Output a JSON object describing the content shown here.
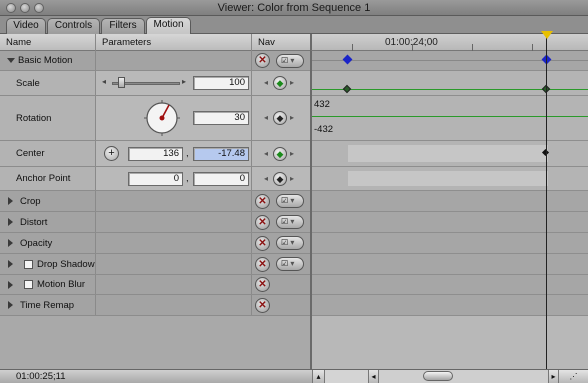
{
  "window": {
    "title": "Viewer: Color from Sequence 1"
  },
  "tabs": [
    {
      "label": "Video"
    },
    {
      "label": "Controls"
    },
    {
      "label": "Filters"
    },
    {
      "label": "Motion"
    }
  ],
  "columns": {
    "name": "Name",
    "parameters": "Parameters",
    "nav": "Nav"
  },
  "timeline": {
    "timecode": "01:00:24;00",
    "rotation_max": "432",
    "rotation_min": "-432"
  },
  "motion": {
    "basic_motion": {
      "label": "Basic Motion"
    },
    "scale": {
      "label": "Scale",
      "value": "100",
      "slider_fraction": 0.1
    },
    "rotation": {
      "label": "Rotation",
      "value": "30"
    },
    "center": {
      "label": "Center",
      "x": "136",
      "y": "-17.48",
      "separator": ","
    },
    "anchor": {
      "label": "Anchor Point",
      "x": "0",
      "y": "0",
      "separator": ","
    },
    "sections": [
      {
        "label": "Crop"
      },
      {
        "label": "Distort"
      },
      {
        "label": "Opacity"
      },
      {
        "label": "Drop Shadow"
      },
      {
        "label": "Motion Blur"
      },
      {
        "label": "Time Remap"
      }
    ]
  },
  "status": {
    "timecode": "01:00:25;11"
  },
  "icons": {
    "reset": "x-circle-icon",
    "menu": "checkmark-menu-icon",
    "keyframe": "diamond-keyframe-icon"
  },
  "colors": {
    "accent_selection": "#b6c9ee",
    "keyframe_blue": "#1a24c8",
    "curve_green": "#2a9a2a",
    "playhead_cap": "#e8c000"
  }
}
